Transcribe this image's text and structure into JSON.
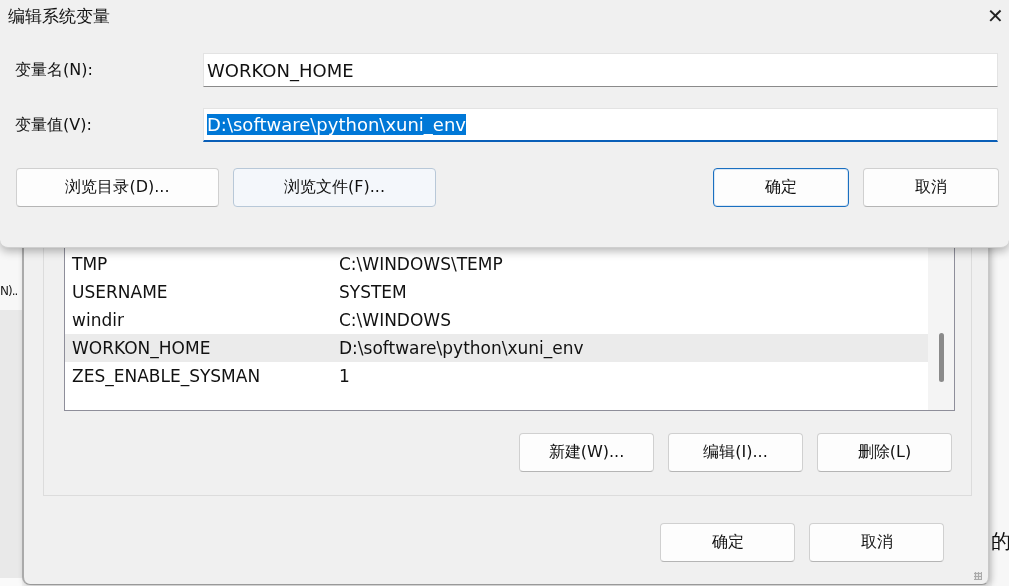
{
  "background_window": {
    "texts": [
      "N)..",
      "的"
    ]
  },
  "env_dialog": {
    "rows": [
      {
        "name": "TMP",
        "value": "C:\\WINDOWS\\TEMP",
        "selected": false
      },
      {
        "name": "USERNAME",
        "value": "SYSTEM",
        "selected": false
      },
      {
        "name": "windir",
        "value": "C:\\WINDOWS",
        "selected": false
      },
      {
        "name": "WORKON_HOME",
        "value": "D:\\software\\python\\xuni_env",
        "selected": true
      },
      {
        "name": "ZES_ENABLE_SYSMAN",
        "value": "1",
        "selected": false
      }
    ],
    "list_buttons": [
      "新建(W)...",
      "编辑(I)...",
      "删除(L)"
    ],
    "footer_buttons": [
      "确定",
      "取消"
    ]
  },
  "edit_dialog": {
    "title": "编辑系统变量",
    "close": "✕",
    "fields": [
      {
        "label": "变量名(N):",
        "value": "WORKON_HOME",
        "focused": false
      },
      {
        "label": "变量值(V):",
        "value": "D:\\software\\python\\xuni_env",
        "focused": true
      }
    ],
    "buttons": [
      {
        "label": "浏览目录(D)...",
        "hovered": false,
        "default": false
      },
      {
        "label": "浏览文件(F)...",
        "hovered": true,
        "default": false
      },
      {
        "label": "确定",
        "hovered": false,
        "default": true
      },
      {
        "label": "取消",
        "hovered": false,
        "default": false
      }
    ]
  }
}
